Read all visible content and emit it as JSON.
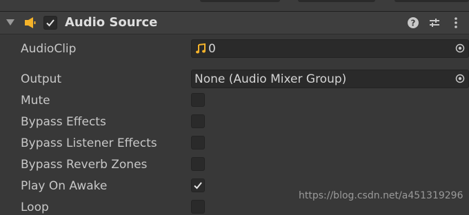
{
  "component": {
    "title": "Audio Source",
    "enabled": true
  },
  "colors": {
    "background": "#383838",
    "field_bg": "#2a2a2a",
    "accent_speaker": "#f5b32a",
    "text": "#d2d2d2"
  },
  "header_icons": [
    "help-icon",
    "preset-icon",
    "more-icon"
  ],
  "fields": {
    "audioclip_label": "AudioClip",
    "audioclip_value": "0",
    "output_label": "Output",
    "output_value": "None (Audio Mixer Group)"
  },
  "toggles": [
    {
      "label": "Mute",
      "checked": false
    },
    {
      "label": "Bypass Effects",
      "checked": false
    },
    {
      "label": "Bypass Listener Effects",
      "checked": false
    },
    {
      "label": "Bypass Reverb Zones",
      "checked": false
    },
    {
      "label": "Play On Awake",
      "checked": true
    },
    {
      "label": "Loop",
      "checked": false
    }
  ],
  "watermark": "https://blog.csdn.net/a451319296"
}
